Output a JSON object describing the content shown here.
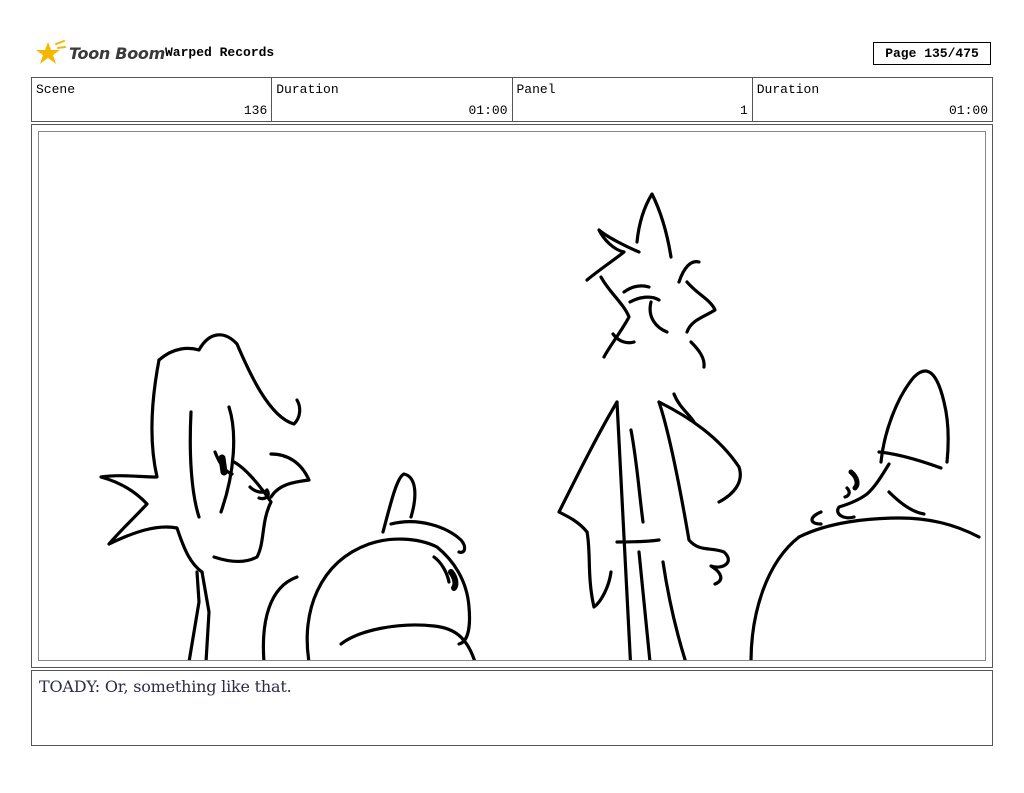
{
  "header": {
    "logo_text": "Toon Boom",
    "project_title": "Warped Records",
    "page_label": "Page 135/475"
  },
  "info": {
    "scene_label": "Scene",
    "scene_value": "136",
    "scene_duration_label": "Duration",
    "scene_duration_value": "01:00",
    "panel_label": "Panel",
    "panel_value": "1",
    "panel_duration_label": "Duration",
    "panel_duration_value": "01:00"
  },
  "dialog": {
    "text": "TOADY:  Or, something like that."
  },
  "colors": {
    "logo_accent": "#f5b800",
    "ink": "#000000",
    "dialog_ink": "#2b2b4a"
  }
}
